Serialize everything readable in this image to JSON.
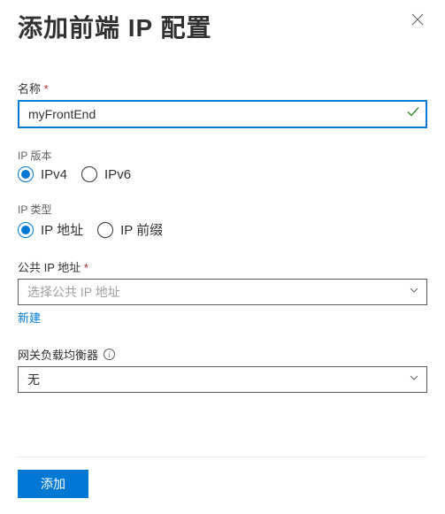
{
  "header": {
    "title": "添加前端 IP 配置"
  },
  "name": {
    "label": "名称",
    "value": "myFrontEnd"
  },
  "ipVersion": {
    "label": "IP 版本",
    "options": [
      {
        "label": "IPv4",
        "selected": true
      },
      {
        "label": "IPv6",
        "selected": false
      }
    ]
  },
  "ipType": {
    "label": "IP 类型",
    "options": [
      {
        "label": "IP 地址",
        "selected": true
      },
      {
        "label": "IP 前缀",
        "selected": false
      }
    ]
  },
  "publicIp": {
    "label": "公共 IP 地址",
    "placeholder": "选择公共 IP 地址",
    "createLink": "新建"
  },
  "gatewayLb": {
    "label": "网关负载均衡器",
    "value": "无"
  },
  "footer": {
    "submit": "添加"
  }
}
